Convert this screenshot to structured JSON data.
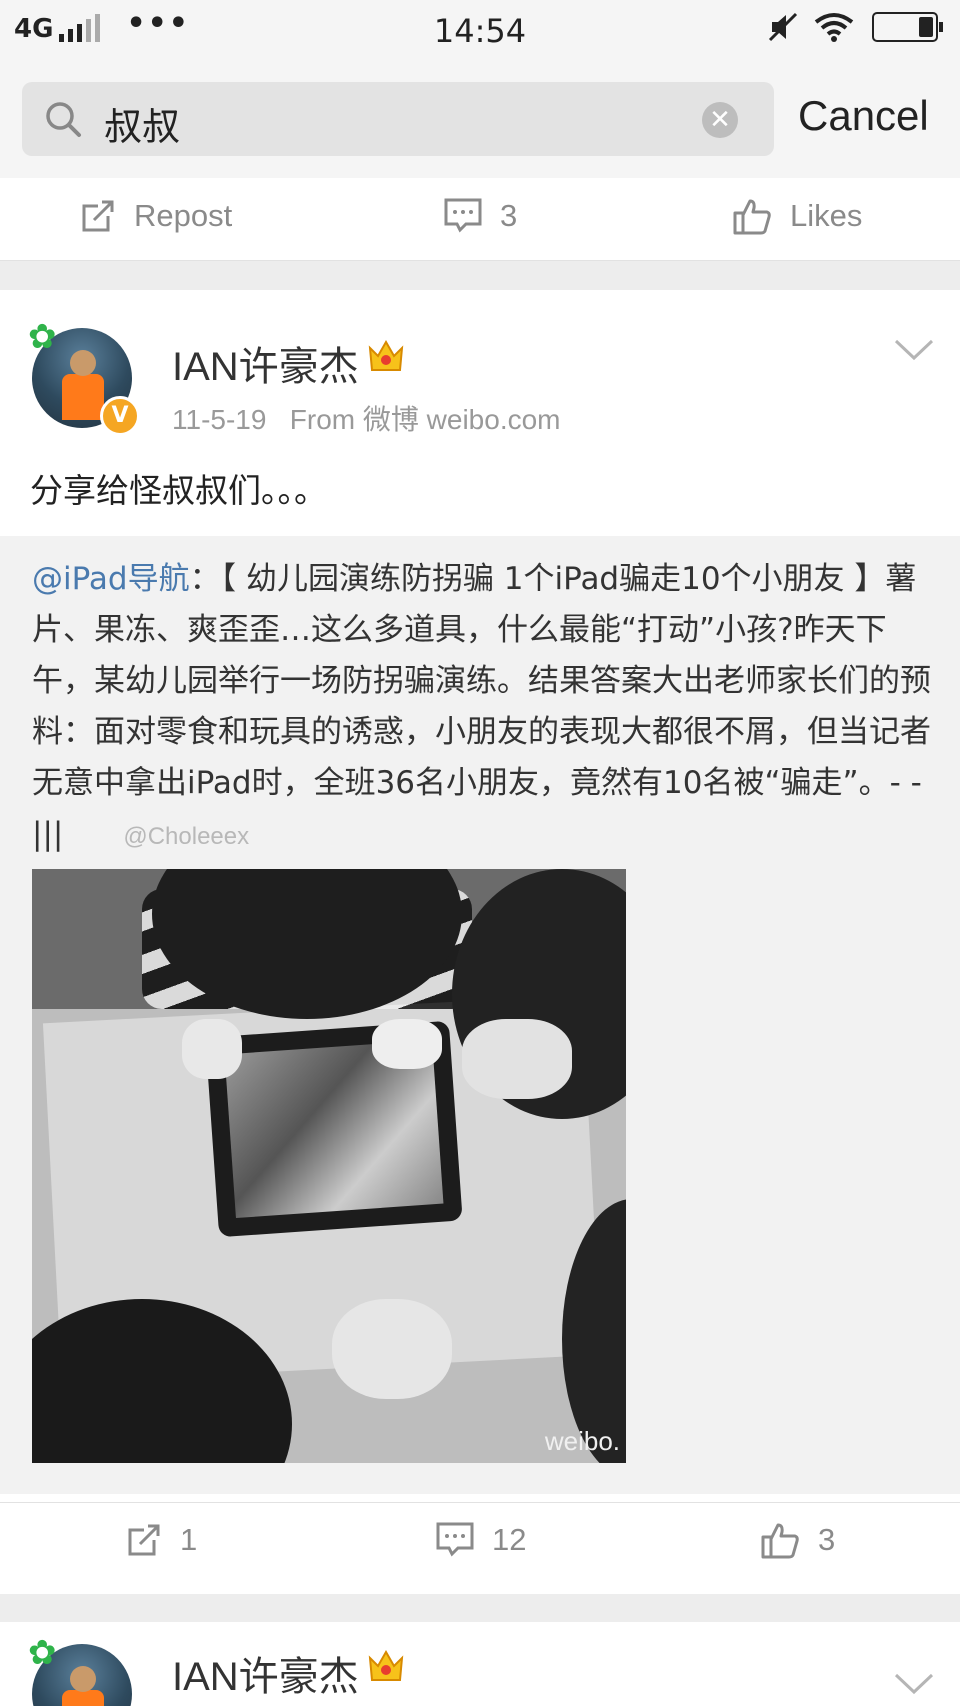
{
  "status_bar": {
    "network": "4G",
    "dots": "•••",
    "time": "14:54"
  },
  "search": {
    "query": "叔叔",
    "cancel_label": "Cancel"
  },
  "prev_post_actions": {
    "repost_label": "Repost",
    "comments": "3",
    "likes_label": "Likes"
  },
  "post": {
    "username": "IAN许豪杰",
    "date": "11-5-19",
    "source": "From 微博 weibo.com",
    "text": "分享给怪叔叔们。。。",
    "repost": {
      "mention": "@iPad导航",
      "body": "：【 幼儿园演练防拐骗 1个iPad骗走10个小朋友 】薯片、果冻、爽歪歪…这么多道具，什么最能“打动”小孩?昨天下午，某幼儿园举行一场防拐骗演练。结果答案大出老师家长们的预料：面对零食和玩具的诱惑，小朋友的表现大都很不屑，但当记者无意中拿出iPad时，全班36名小朋友，竟然有10名被“骗走”。- -|||",
      "watermark": "@Choleeex",
      "image_watermark": "weibo."
    },
    "actions": {
      "reposts": "1",
      "comments": "12",
      "likes": "3"
    }
  },
  "next_post": {
    "username": "IAN许豪杰"
  }
}
